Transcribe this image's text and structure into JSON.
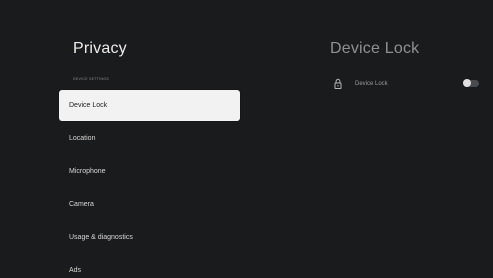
{
  "left_panel": {
    "title": "Privacy",
    "section_label": "DEVICE SETTINGS",
    "items": [
      {
        "label": "Device Lock"
      },
      {
        "label": "Location"
      },
      {
        "label": "Microphone"
      },
      {
        "label": "Camera"
      },
      {
        "label": "Usage & diagnostics"
      },
      {
        "label": "Ads"
      }
    ]
  },
  "right_panel": {
    "title": "Device Lock",
    "row": {
      "icon": "lock-icon",
      "label": "Device Lock",
      "toggle_state": "off"
    }
  },
  "colors": {
    "background": "#1a1b1d",
    "selected_item_bg": "#f2f2f2",
    "selected_item_text": "#222222",
    "muted_text": "#8f9092"
  }
}
